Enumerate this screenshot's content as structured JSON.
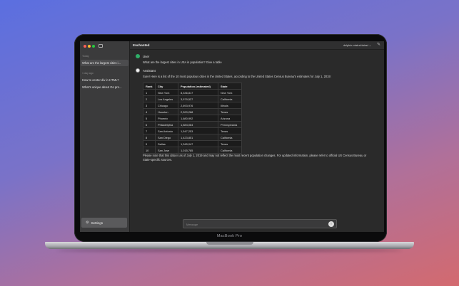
{
  "device": {
    "label": "MacBook Pro"
  },
  "colors": {
    "accent_user": "#2fae68",
    "sidebar_bg": "#3b3b3c",
    "main_bg": "#2a2a2a"
  },
  "app": {
    "title": "Enchanted",
    "model": "dolphin-mistral:latest ⌄"
  },
  "sidebar": {
    "sections": [
      {
        "label": "Today",
        "items": [
          {
            "label": "What are the largest cities i..."
          }
        ]
      },
      {
        "label": "1 day ago",
        "items": [
          {
            "label": "How to center div in HTML?"
          },
          {
            "label": "What's unique about Go pro..."
          }
        ]
      }
    ],
    "settings_label": "Settings"
  },
  "conversation": {
    "user": {
      "role": "User",
      "text": "What are the largest cities in USA in population? Give a table"
    },
    "assistant": {
      "role": "Assistant",
      "intro": "Sure! Here is a list of the 10 most populous cities in the United States, according to the United States Census Bureau's estimates for July 1, 2019:",
      "table": {
        "headers": [
          "Rank",
          "City",
          "Population (estimated)",
          "State"
        ],
        "rows": [
          [
            "1",
            "New York",
            "8,336,817",
            "New York"
          ],
          [
            "2",
            "Los Angeles",
            "3,979,537",
            "California"
          ],
          [
            "3",
            "Chicago",
            "2,693,976",
            "Illinois"
          ],
          [
            "4",
            "Houston",
            "2,320,268",
            "Texas"
          ],
          [
            "5",
            "Phoenix",
            "1,680,992",
            "Arizona"
          ],
          [
            "6",
            "Philadelphia",
            "1,584,064",
            "Pennsylvania"
          ],
          [
            "7",
            "San Antonio",
            "1,547,253",
            "Texas"
          ],
          [
            "8",
            "San Diego",
            "1,423,851",
            "California"
          ],
          [
            "9",
            "Dallas",
            "1,345,047",
            "Texas"
          ],
          [
            "10",
            "San Jose",
            "1,015,785",
            "California"
          ]
        ]
      },
      "outro": "Please note that this data is as of July 1, 2019 and may not reflect the most recent population changes. For updated information, please refer to official US Census Bureau or State-specific sources."
    }
  },
  "input": {
    "placeholder": "Message",
    "value": ""
  }
}
